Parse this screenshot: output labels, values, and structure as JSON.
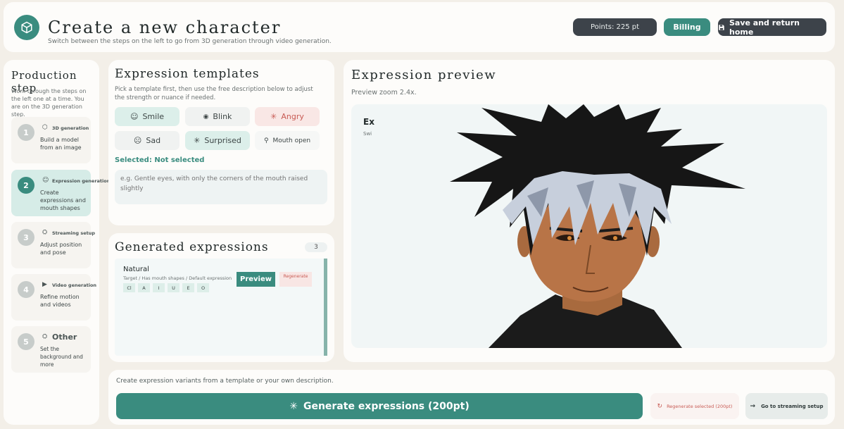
{
  "header": {
    "title": "Create a new character",
    "subtitle": "Switch between the steps on the left to go from 3D generation through video generation.",
    "points": "Points: 225 pt",
    "billing": "Billing",
    "save_home": "Save and return home"
  },
  "sidebar": {
    "title": "Production step",
    "intro": "Work through the steps on the left one at a time. You are on the 3D generation step.",
    "steps": [
      {
        "num": "1",
        "icon": "cube-icon",
        "name": "3D generation",
        "desc": "Build a model from an image",
        "active": false
      },
      {
        "num": "2",
        "icon": "smile-icon",
        "name": "Expression generation",
        "desc": "Create expressions and mouth shapes",
        "active": true
      },
      {
        "num": "3",
        "icon": "person-icon",
        "name": "Streaming setup",
        "desc": "Adjust position and pose",
        "active": false
      },
      {
        "num": "4",
        "icon": "play-icon",
        "name": "Video generation",
        "desc": "Refine motion and videos",
        "active": false
      },
      {
        "num": "5",
        "icon": "person-icon",
        "name": "Other",
        "desc": "Set the background and more",
        "active": false
      }
    ]
  },
  "templates": {
    "title": "Expression templates",
    "description": "Pick a template first, then use the free description below to adjust the strength or nuance if needed.",
    "chips": [
      {
        "label": "Smile",
        "icon": "smile-icon"
      },
      {
        "label": "Blink",
        "icon": "eye-icon"
      },
      {
        "label": "Angry",
        "icon": "sparkle-icon"
      },
      {
        "label": "Sad",
        "icon": "sad-icon"
      },
      {
        "label": "Surprised",
        "icon": "sparkle-icon"
      },
      {
        "label": "Mouth open",
        "icon": "mic-icon"
      }
    ],
    "selected": "Selected: Not selected",
    "placeholder": "e.g. Gentle eyes, with only the corners of the mouth raised slightly"
  },
  "generated": {
    "title": "Generated expressions",
    "count": "3",
    "item": {
      "name": "Natural",
      "meta": "Target / Has mouth shapes / Default expression",
      "mouth_shapes": [
        "Cl",
        "A",
        "I",
        "U",
        "E",
        "O"
      ],
      "preview": "Preview",
      "regenerate": "Regenerate"
    }
  },
  "preview": {
    "title": "Expression preview",
    "zoom": "Preview zoom 2.4x.",
    "mini_title": "Ex",
    "mini_sub": "Swi"
  },
  "bottom": {
    "hint": "Create expression variants from a template or your own description.",
    "generate": "Generate expressions (200pt)",
    "regenerate_selected": "Regenerate selected (200pt)",
    "go_streaming": "Go to streaming setup"
  },
  "colors": {
    "accent": "#3a8c7f",
    "dark": "#3d434a",
    "danger": "#c85b54",
    "background": "#f3efe8"
  }
}
